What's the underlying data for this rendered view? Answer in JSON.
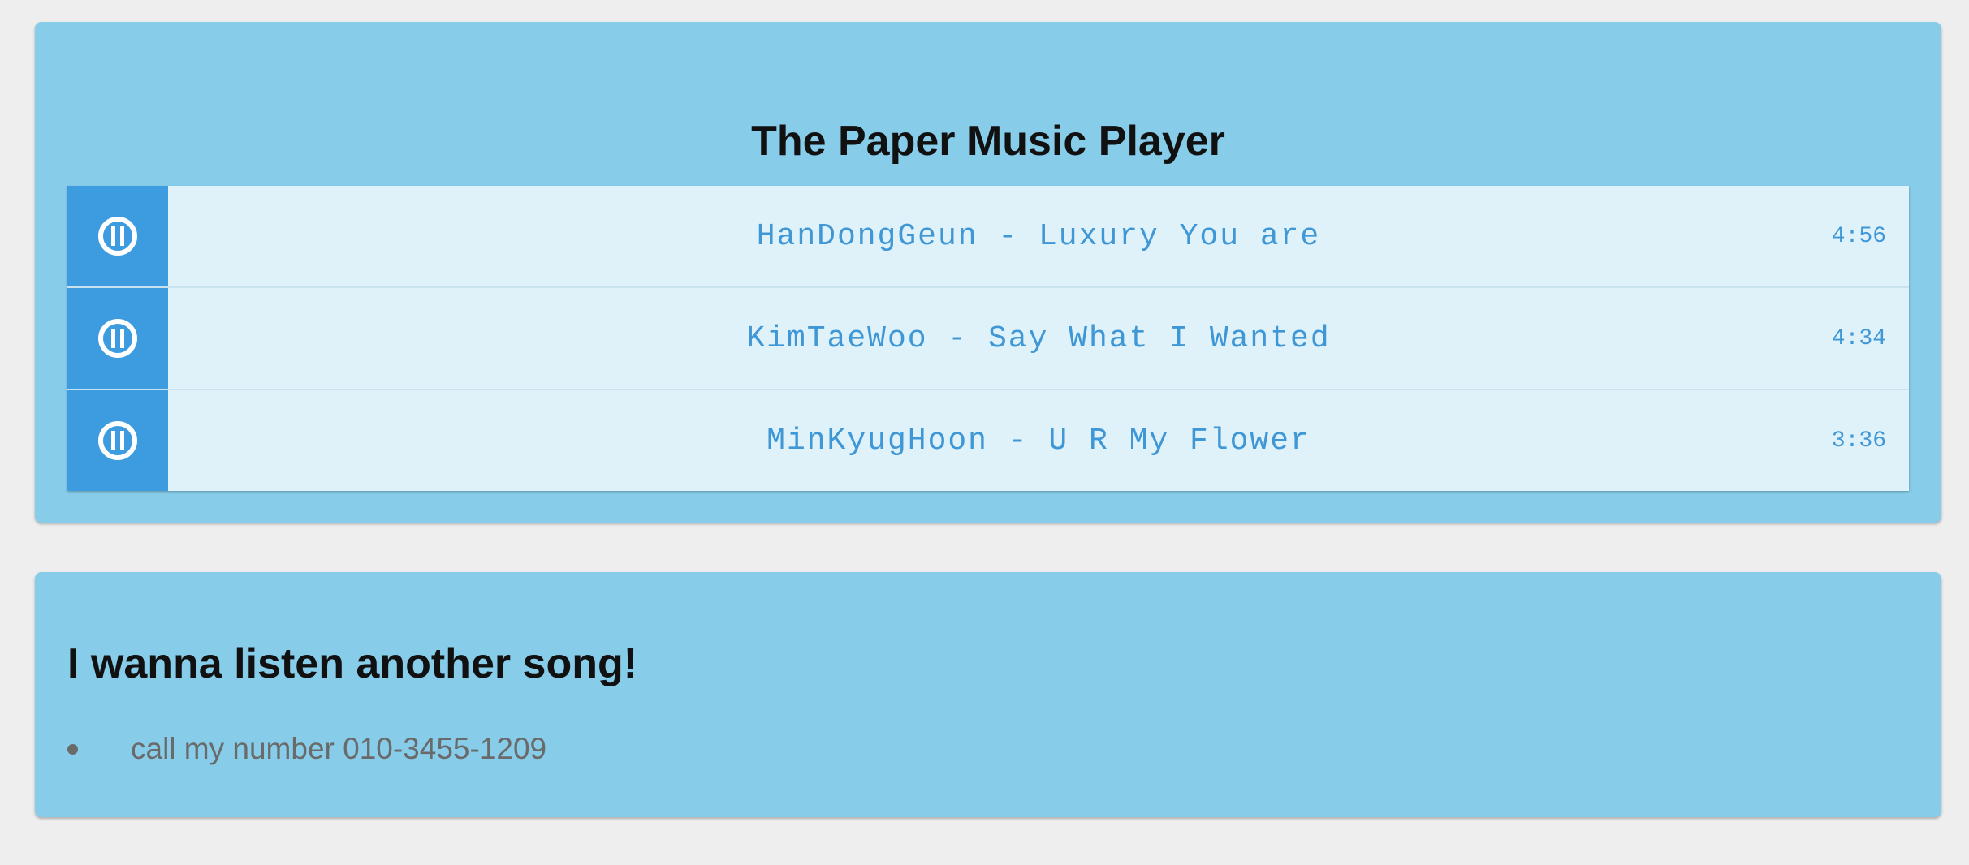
{
  "player": {
    "title": "The Paper Music Player",
    "tracks": [
      {
        "title": "HanDongGeun - Luxury You are",
        "duration": "4:56",
        "icon": "play-circle-icon"
      },
      {
        "title": "KimTaeWoo - Say What I Wanted",
        "duration": "4:34",
        "icon": "play-circle-icon"
      },
      {
        "title": "MinKyugHoon - U R My Flower",
        "duration": "3:36",
        "icon": "play-circle-icon"
      }
    ]
  },
  "contact": {
    "title": "I wanna listen another song!",
    "items": [
      {
        "text": "call my number 010-3455-1209"
      }
    ]
  },
  "colors": {
    "background": "#eeeeee",
    "card": "#87cdea",
    "button": "#3d9be0",
    "track_row": "#dff2fa",
    "track_text": "#3f97d6"
  }
}
